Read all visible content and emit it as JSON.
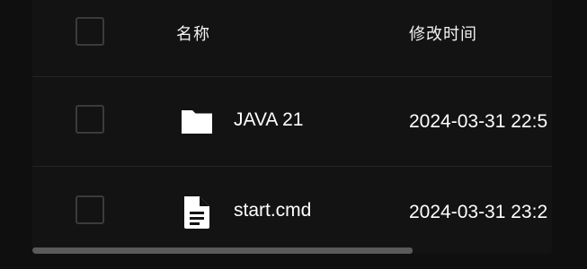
{
  "table": {
    "headers": {
      "name": "名称",
      "modified": "修改时间"
    },
    "rows": [
      {
        "icon": "folder-icon",
        "name": "JAVA 21",
        "modified": "2024-03-31 22:5"
      },
      {
        "icon": "document-icon",
        "name": "start.cmd",
        "modified": "2024-03-31 23:2"
      }
    ]
  },
  "colors": {
    "background": "#0f0f0f",
    "panel": "#131313",
    "checkbox_border": "#3b3b3b",
    "divider": "#252525",
    "scrollbar": "#5a5a5a"
  }
}
